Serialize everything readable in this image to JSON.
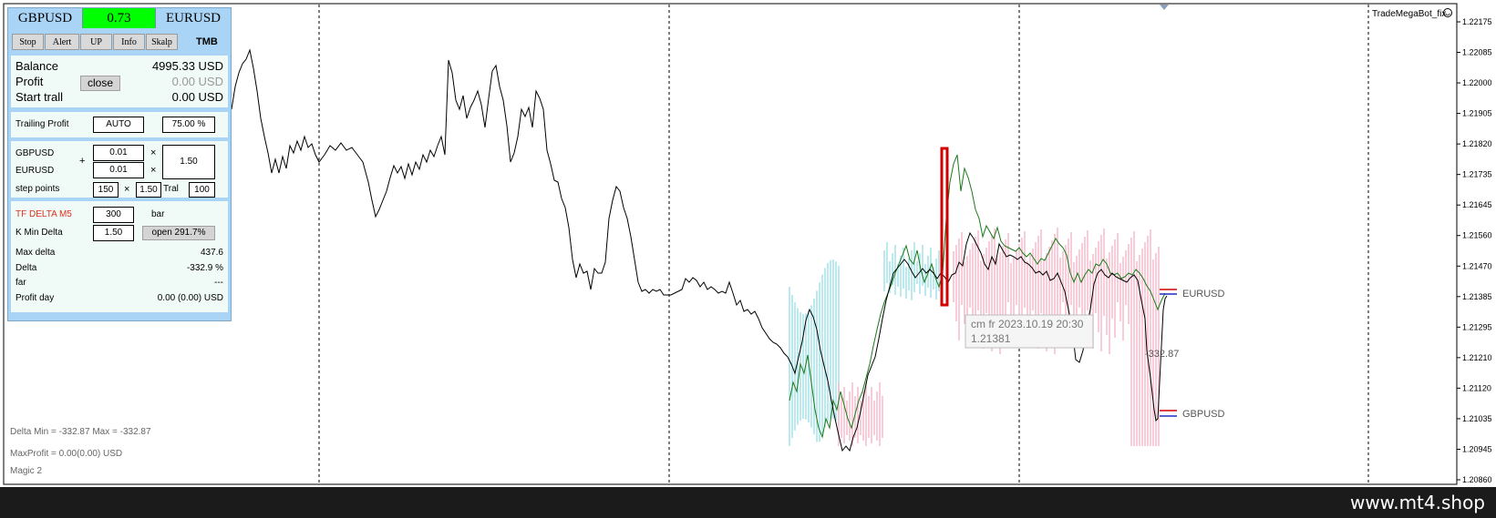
{
  "panel": {
    "symbol_left": "GBPUSD",
    "ratio": "0.73",
    "symbol_right": "EURUSD",
    "tabs": [
      "Stop",
      "Alert",
      "UP",
      "Info",
      "Skalp"
    ],
    "brand": "TMB",
    "balance_label": "Balance",
    "balance_value": "4995.33 USD",
    "profit_label": "Profit",
    "profit_value": "0.00 USD",
    "close_label": "close",
    "start_trall_label": "Start trall",
    "start_trall_value": "0.00 USD",
    "trailing_profit_label": "Trailing Profit",
    "trailing_mode": "AUTO",
    "trailing_pct": "75.00 %",
    "pair1_name": "GBPUSD",
    "pair1_lot": "0.01",
    "pair2_name": "EURUSD",
    "pair2_lot": "0.01",
    "plus_sign": "+",
    "times1": "×",
    "times2": "×",
    "times3": "×",
    "mult_value": "1.50",
    "step_label": "step points",
    "step_value": "150",
    "step_mult": "1.50",
    "tral_label": "Tral",
    "tral_value": "100",
    "tf_label": "TF DELTA M5",
    "tf_value": "300",
    "tf_unit": "bar",
    "kmin_label": "K Min Delta",
    "kmin_value": "1.50",
    "open_label": "open 291.7%",
    "max_delta_label": "Max delta",
    "max_delta_value": "437.6",
    "delta_label": "Delta",
    "delta_value": "-332.9 %",
    "far_label": "far",
    "far_value": "---",
    "profit_day_label": "Profit day",
    "profit_day_value": "0.00  (0.00) USD"
  },
  "status": {
    "delta_minmax": "Delta Min = -332.87  Max = -332.87",
    "maxprofit": "MaxProfit = 0.00(0.00) USD",
    "magic": "Magic 2"
  },
  "chart": {
    "expert_name": "TradeMegaBot_fix",
    "eur_label": "EURUSD",
    "gbp_label": "GBPUSD",
    "delta_value_label": "-332.87",
    "tooltip_line1": "cm fr 2023.10.19 20:30",
    "tooltip_line2": "1.21381",
    "price_axis": [
      "1.22175",
      "1.22085",
      "1.22000",
      "1.21905",
      "1.21820",
      "1.21735",
      "1.21645",
      "1.21560",
      "1.21470",
      "1.21385",
      "1.21295",
      "1.21210",
      "1.21120",
      "1.21035",
      "1.20945",
      "1.20860"
    ]
  },
  "footer": {
    "watermark": "www.mt4.shop"
  },
  "colors": {
    "panel_bg": "#a9d4f5",
    "ratio_bg": "#00ff00",
    "tf_red": "#e0301e",
    "pink_hist": "#f4b6c8",
    "cyan_hist": "#9ee0e6",
    "price_line": "#000000",
    "green_line": "#1a7a1a",
    "highlight_red": "#d00000"
  }
}
